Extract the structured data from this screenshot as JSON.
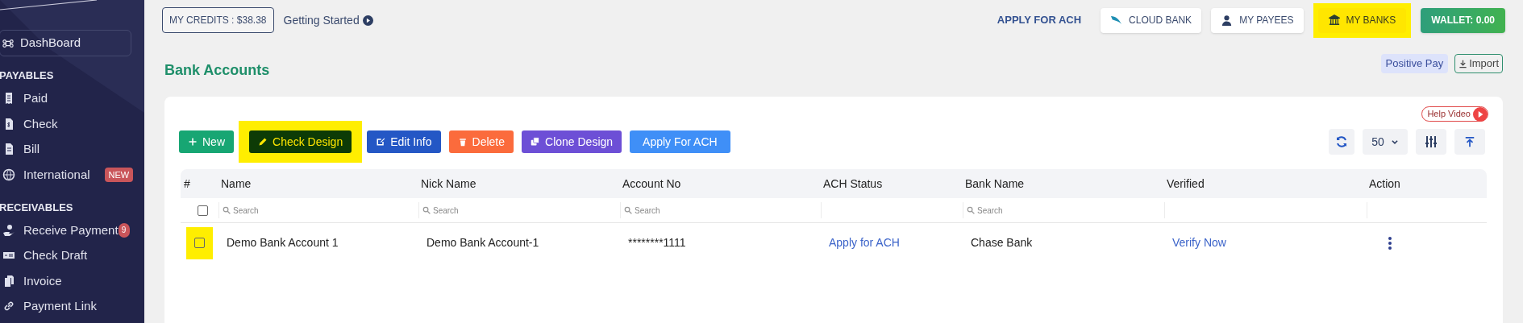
{
  "sidebar": {
    "dashboard": "DashBoard",
    "sections": [
      {
        "title": "PAYABLES",
        "items": [
          {
            "label": "Paid"
          },
          {
            "label": "Check"
          },
          {
            "label": "Bill"
          },
          {
            "label": "International",
            "badge": "NEW"
          }
        ]
      },
      {
        "title": "RECEIVABLES",
        "items": [
          {
            "label": "Receive Payment",
            "count": "9"
          },
          {
            "label": "Check Draft"
          },
          {
            "label": "Invoice"
          },
          {
            "label": "Payment Link"
          }
        ]
      }
    ]
  },
  "top_bar": {
    "credits": "MY CREDITS : $38.38",
    "getting_started": "Getting Started",
    "actions": [
      {
        "kind": "link",
        "label": "APPLY FOR ACH",
        "highlighted": false
      },
      {
        "kind": "white",
        "label": "CLOUD BANK",
        "highlighted": false
      },
      {
        "kind": "white",
        "label": "MY PAYEES",
        "highlighted": false
      },
      {
        "kind": "yellow",
        "label": "MY BANKS",
        "highlighted": true
      },
      {
        "kind": "green",
        "label": "WALLET: 0.00",
        "highlighted": false
      }
    ]
  },
  "page": {
    "title": "Bank Accounts",
    "positive_pay": "Positive Pay",
    "import": "Import"
  },
  "toolbar": {
    "help_video": "Help Video",
    "buttons": [
      {
        "label": "New",
        "color": "#17a673",
        "highlighted": false
      },
      {
        "label": "Check Design",
        "color": "#0d3b06",
        "highlighted": true
      },
      {
        "label": "Edit Info",
        "color": "#2457c5",
        "highlighted": false
      },
      {
        "label": "Delete",
        "color": "#fb6b3c",
        "highlighted": false
      },
      {
        "label": "Clone Design",
        "color": "#6d4fd6",
        "highlighted": false
      },
      {
        "label": "Apply For ACH",
        "color": "#3f8ff7",
        "highlighted": false
      }
    ],
    "page_size": "50"
  },
  "table": {
    "columns": [
      {
        "label": "#"
      },
      {
        "label": "Name",
        "placeholder": "Search"
      },
      {
        "label": "Nick Name",
        "placeholder": "Search"
      },
      {
        "label": "Account No",
        "placeholder": "Search"
      },
      {
        "label": "ACH Status"
      },
      {
        "label": "Bank Name",
        "placeholder": "Search"
      },
      {
        "label": "Verified"
      },
      {
        "label": "Action"
      }
    ],
    "select_all": {
      "checked": false
    },
    "rows": [
      {
        "checked": false,
        "highlighted": true,
        "cells": [
          "",
          "Demo Bank Account 1",
          "Demo Bank Account-1",
          "********1111",
          "Apply for ACH",
          "Chase Bank",
          "Verify Now"
        ]
      }
    ]
  }
}
